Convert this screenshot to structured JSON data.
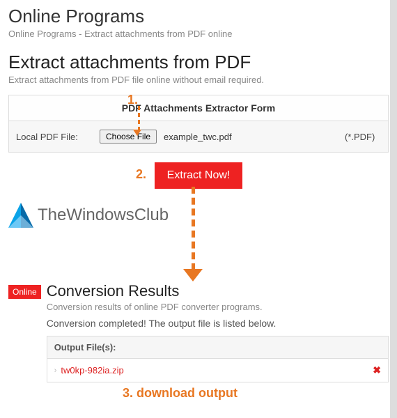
{
  "header": {
    "title": "Online Programs",
    "subtitle": "Online Programs - Extract attachments from PDF online"
  },
  "section": {
    "title": "Extract attachments from PDF",
    "subtitle": "Extract attachments from PDF file online without email required."
  },
  "form": {
    "panel_title": "PDF Attachments Extractor Form",
    "file_label": "Local PDF File:",
    "choose_button": "Choose File",
    "filename": "example_twc.pdf",
    "ext_hint": "(*.PDF)"
  },
  "action": {
    "extract_button": "Extract Now!"
  },
  "watermark": {
    "text": "TheWindowsClub"
  },
  "results": {
    "badge": "Online",
    "title": "Conversion Results",
    "subtitle": "Conversion results of online PDF converter programs.",
    "status": "Conversion completed! The output file is listed below.",
    "output_header": "Output File(s):",
    "output_file": "tw0kp-982ia.zip"
  },
  "annotations": {
    "step1": "1.",
    "step2": "2.",
    "step3": "3. download output"
  }
}
